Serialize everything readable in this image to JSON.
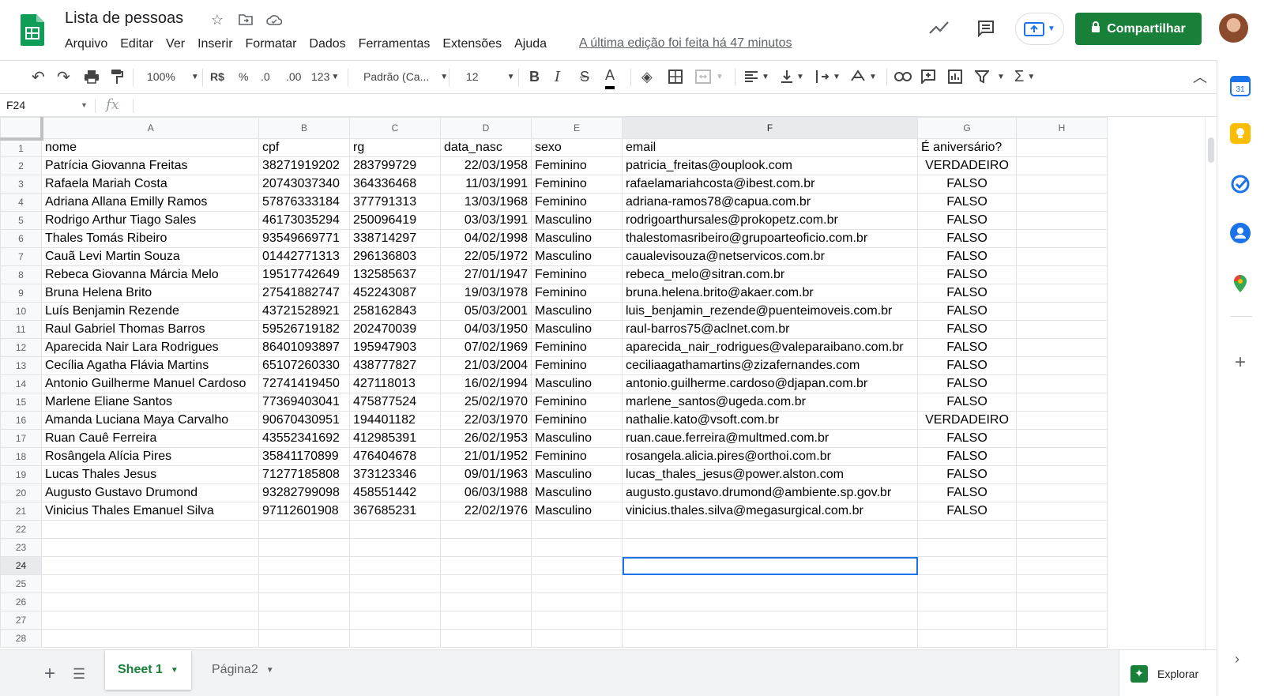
{
  "doc": {
    "title": "Lista de pessoas",
    "last_edit": "A última edição foi feita há 47 minutos"
  },
  "menu": [
    "Arquivo",
    "Editar",
    "Ver",
    "Inserir",
    "Formatar",
    "Dados",
    "Ferramentas",
    "Extensões",
    "Ajuda"
  ],
  "share_label": "Compartilhar",
  "toolbar": {
    "zoom": "100%",
    "currency": "R$",
    "percent": "%",
    "dec_less": ".0",
    "dec_more": ".00",
    "number_format": "123",
    "font": "Padrão (Ca...",
    "font_size": "12"
  },
  "formula_bar": {
    "cell_ref": "F24",
    "fx": "fx"
  },
  "grid": {
    "columns": [
      "A",
      "B",
      "C",
      "D",
      "E",
      "F",
      "G",
      "H"
    ],
    "rows": [
      [
        "nome",
        "cpf",
        "rg",
        "data_nasc",
        "sexo",
        "email",
        "É aniversário?",
        ""
      ],
      [
        "Patrícia Giovanna Freitas",
        "38271919202",
        "283799729",
        "22/03/1958",
        "Feminino",
        "patricia_freitas@ouplook.com",
        "VERDADEIRO",
        ""
      ],
      [
        "Rafaela Mariah Costa",
        "20743037340",
        "364336468",
        "11/03/1991",
        "Feminino",
        "rafaelamariahcosta@ibest.com.br",
        "FALSO",
        ""
      ],
      [
        "Adriana Allana Emilly Ramos",
        "57876333184",
        "377791313",
        "13/03/1968",
        "Feminino",
        "adriana-ramos78@capua.com.br",
        "FALSO",
        ""
      ],
      [
        "Rodrigo Arthur Tiago Sales",
        "46173035294",
        "250096419",
        "03/03/1991",
        "Masculino",
        "rodrigoarthursales@prokopetz.com.br",
        "FALSO",
        ""
      ],
      [
        "Thales Tomás Ribeiro",
        "93549669771",
        "338714297",
        "04/02/1998",
        "Masculino",
        "thalestomasribeiro@grupoarteoficio.com.br",
        "FALSO",
        ""
      ],
      [
        "Cauã Levi Martin Souza",
        "01442771313",
        "296136803",
        "22/05/1972",
        "Masculino",
        "caualevisouza@netservicos.com.br",
        "FALSO",
        ""
      ],
      [
        "Rebeca Giovanna Márcia Melo",
        "19517742649",
        "132585637",
        "27/01/1947",
        "Feminino",
        "rebeca_melo@sitran.com.br",
        "FALSO",
        ""
      ],
      [
        "Bruna Helena Brito",
        "27541882747",
        "452243087",
        "19/03/1978",
        "Feminino",
        "bruna.helena.brito@akaer.com.br",
        "FALSO",
        ""
      ],
      [
        "Luís Benjamin Rezende",
        "43721528921",
        "258162843",
        "05/03/2001",
        "Masculino",
        "luis_benjamin_rezende@puenteimoveis.com.br",
        "FALSO",
        ""
      ],
      [
        "Raul Gabriel Thomas Barros",
        "59526719182",
        "202470039",
        "04/03/1950",
        "Masculino",
        "raul-barros75@aclnet.com.br",
        "FALSO",
        ""
      ],
      [
        "Aparecida Nair Lara Rodrigues",
        "86401093897",
        "195947903",
        "07/02/1969",
        "Feminino",
        "aparecida_nair_rodrigues@valeparaibano.com.br",
        "FALSO",
        ""
      ],
      [
        "Cecília Agatha Flávia Martins",
        "65107260330",
        "438777827",
        "21/03/2004",
        "Feminino",
        "ceciliaagathamartins@zizafernandes.com",
        "FALSO",
        ""
      ],
      [
        "Antonio Guilherme Manuel Cardoso",
        "72741419450",
        "427118013",
        "16/02/1994",
        "Masculino",
        "antonio.guilherme.cardoso@djapan.com.br",
        "FALSO",
        ""
      ],
      [
        "Marlene Eliane Santos",
        "77369403041",
        "475877524",
        "25/02/1970",
        "Feminino",
        "marlene_santos@ugeda.com.br",
        "FALSO",
        ""
      ],
      [
        "Amanda Luciana Maya Carvalho",
        "90670430951",
        "194401182",
        "22/03/1970",
        "Feminino",
        "nathalie.kato@vsoft.com.br",
        "VERDADEIRO",
        ""
      ],
      [
        "Ruan Cauê Ferreira",
        "43552341692",
        "412985391",
        "26/02/1953",
        "Masculino",
        "ruan.caue.ferreira@multmed.com.br",
        "FALSO",
        ""
      ],
      [
        "Rosângela Alícia Pires",
        "35841170899",
        "476404678",
        "21/01/1952",
        "Feminino",
        "rosangela.alicia.pires@orthoi.com.br",
        "FALSO",
        ""
      ],
      [
        "Lucas Thales Jesus",
        "71277185808",
        "373123346",
        "09/01/1963",
        "Masculino",
        "lucas_thales_jesus@power.alston.com",
        "FALSO",
        ""
      ],
      [
        "Augusto Gustavo Drumond",
        "93282799098",
        "458551442",
        "06/03/1988",
        "Masculino",
        "augusto.gustavo.drumond@ambiente.sp.gov.br",
        "FALSO",
        ""
      ],
      [
        "Vinicius Thales Emanuel Silva",
        "97112601908",
        "367685231",
        "22/02/1976",
        "Masculino",
        "vinicius.thales.silva@megasurgical.com.br",
        "FALSO",
        ""
      ],
      [
        "",
        "",
        "",
        "",
        "",
        "",
        "",
        ""
      ],
      [
        "",
        "",
        "",
        "",
        "",
        "",
        "",
        ""
      ],
      [
        "",
        "",
        "",
        "",
        "",
        "",
        "",
        ""
      ],
      [
        "",
        "",
        "",
        "",
        "",
        "",
        "",
        ""
      ],
      [
        "",
        "",
        "",
        "",
        "",
        "",
        "",
        ""
      ],
      [
        "",
        "",
        "",
        "",
        "",
        "",
        "",
        ""
      ],
      [
        "",
        "",
        "",
        "",
        "",
        "",
        "",
        ""
      ]
    ],
    "selected_cell": "F24"
  },
  "sheets": [
    "Sheet 1",
    "Página2"
  ],
  "explore_label": "Explorar",
  "colors": {
    "brand_green": "#188038",
    "selection_blue": "#1a73e8",
    "header_bg": "#f8f9fa"
  },
  "side_panel_icons": [
    "calendar-icon",
    "keep-icon",
    "tasks-icon",
    "contacts-icon",
    "maps-icon",
    "add-icon"
  ]
}
